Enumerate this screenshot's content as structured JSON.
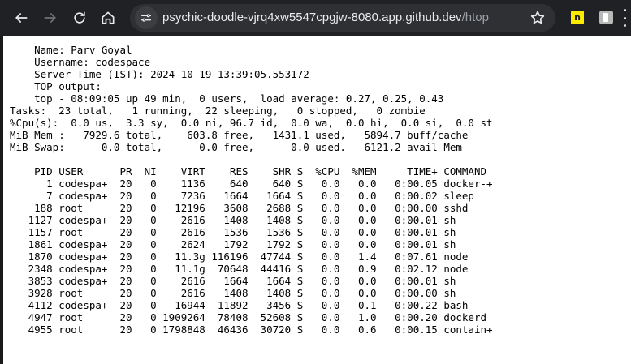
{
  "browser": {
    "url_host": "psychic-doodle-vjrq4xw5547cpgjw-8080.app.github.dev",
    "url_path": "/htop",
    "extension_badge": "n"
  },
  "page": {
    "lines": [
      "    Name: Parv Goyal",
      "    Username: codespace",
      "    Server Time (IST): 2024-10-19 13:39:05.553172",
      "    TOP output:",
      "    top - 08:09:05 up 49 min,  0 users,  load average: 0.27, 0.25, 0.43",
      "Tasks:  23 total,   1 running,  22 sleeping,   0 stopped,   0 zombie",
      "%Cpu(s):  0.0 us,  3.3 sy,  0.0 ni, 96.7 id,  0.0 wa,  0.0 hi,  0.0 si,  0.0 st",
      "MiB Mem :   7929.6 total,    603.8 free,   1431.1 used,   5894.7 buff/cache",
      "MiB Swap:      0.0 total,      0.0 free,      0.0 used.   6121.2 avail Mem",
      "",
      "    PID USER      PR  NI    VIRT    RES    SHR S  %CPU  %MEM     TIME+ COMMAND",
      "      1 codespa+  20   0    1136    640    640 S   0.0   0.0   0:00.05 docker-+",
      "      7 codespa+  20   0    7236   1664   1664 S   0.0   0.0   0:00.02 sleep",
      "    188 root      20   0   12196   3608   2688 S   0.0   0.0   0:00.00 sshd",
      "   1127 codespa+  20   0    2616   1408   1408 S   0.0   0.0   0:00.01 sh",
      "   1157 root      20   0    2616   1536   1536 S   0.0   0.0   0:00.01 sh",
      "   1861 codespa+  20   0    2624   1792   1792 S   0.0   0.0   0:00.01 sh",
      "   1870 codespa+  20   0   11.3g 116196  47744 S   0.0   1.4   0:07.61 node",
      "   2348 codespa+  20   0   11.1g  70648  44416 S   0.0   0.9   0:02.12 node",
      "   3853 codespa+  20   0    2616   1664   1664 S   0.0   0.0   0:00.01 sh",
      "   3928 root      20   0    2616   1408   1408 S   0.0   0.0   0:00.00 sh",
      "   4112 codespa+  20   0   16944  11892   3456 S   0.0   0.1   0:00.22 bash",
      "   4947 root      20   0 1909264  78408  52608 S   0.0   1.0   0:00.20 dockerd",
      "   4955 root      20   0 1798848  46436  30720 S   0.0   0.6   0:00.15 contain+"
    ]
  }
}
